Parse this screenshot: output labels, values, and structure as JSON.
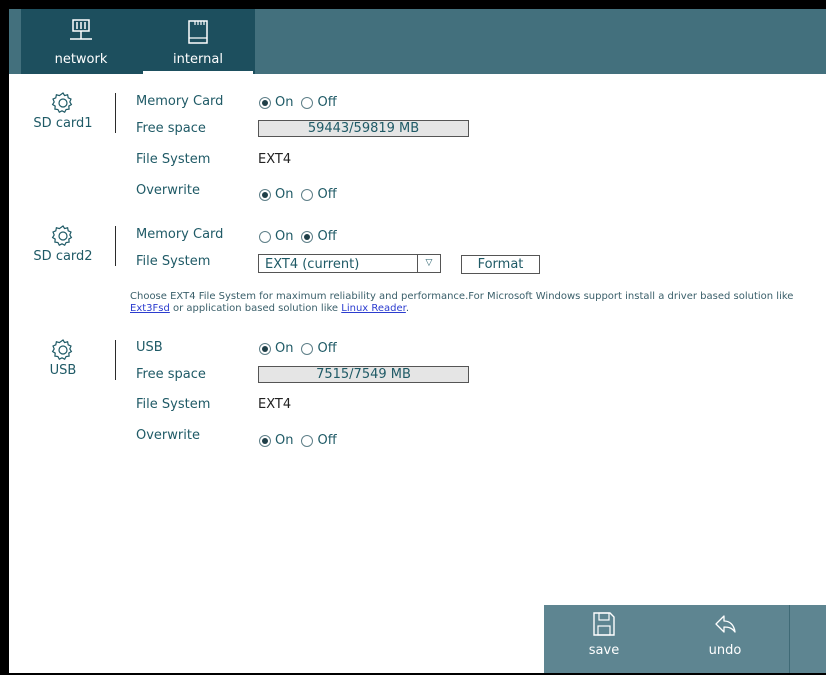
{
  "tabs": [
    {
      "label": "network",
      "icon": "network-icon"
    },
    {
      "label": "internal",
      "icon": "sd-card-icon"
    }
  ],
  "sd_card1": {
    "title": "SD card1",
    "memory_card_label": "Memory Card",
    "memory_card_state": "On",
    "free_space_label": "Free space",
    "free_space_value": "59443/59819 MB",
    "file_system_label": "File System",
    "file_system_value": "EXT4",
    "overwrite_label": "Overwrite",
    "overwrite_state": "On"
  },
  "sd_card2": {
    "title": "SD card2",
    "memory_card_label": "Memory Card",
    "memory_card_state": "Off",
    "file_system_label": "File System",
    "file_system_selected": "EXT4 (current)",
    "format_label": "Format",
    "note_text_1": "Choose EXT4 File System for maximum reliability and performance.For Microsoft Windows support install a driver based solution like ",
    "note_link_1": "Ext3Fsd",
    "note_text_2": " or application based solution like ",
    "note_link_2": "Linux Reader",
    "note_text_3": "."
  },
  "usb": {
    "title": "USB",
    "usb_label": "USB",
    "usb_state": "On",
    "free_space_label": "Free space",
    "free_space_value": "7515/7549 MB",
    "file_system_label": "File System",
    "file_system_value": "EXT4",
    "overwrite_label": "Overwrite",
    "overwrite_state": "On"
  },
  "radio": {
    "on": "On",
    "off": "Off"
  },
  "bottom": {
    "save_label": "save",
    "undo_label": "undo"
  },
  "colors": {
    "topbar": "#43707d",
    "tab_active": "#1d4f5e",
    "bottombar": "#5e8591",
    "text": "#1f5a66"
  }
}
